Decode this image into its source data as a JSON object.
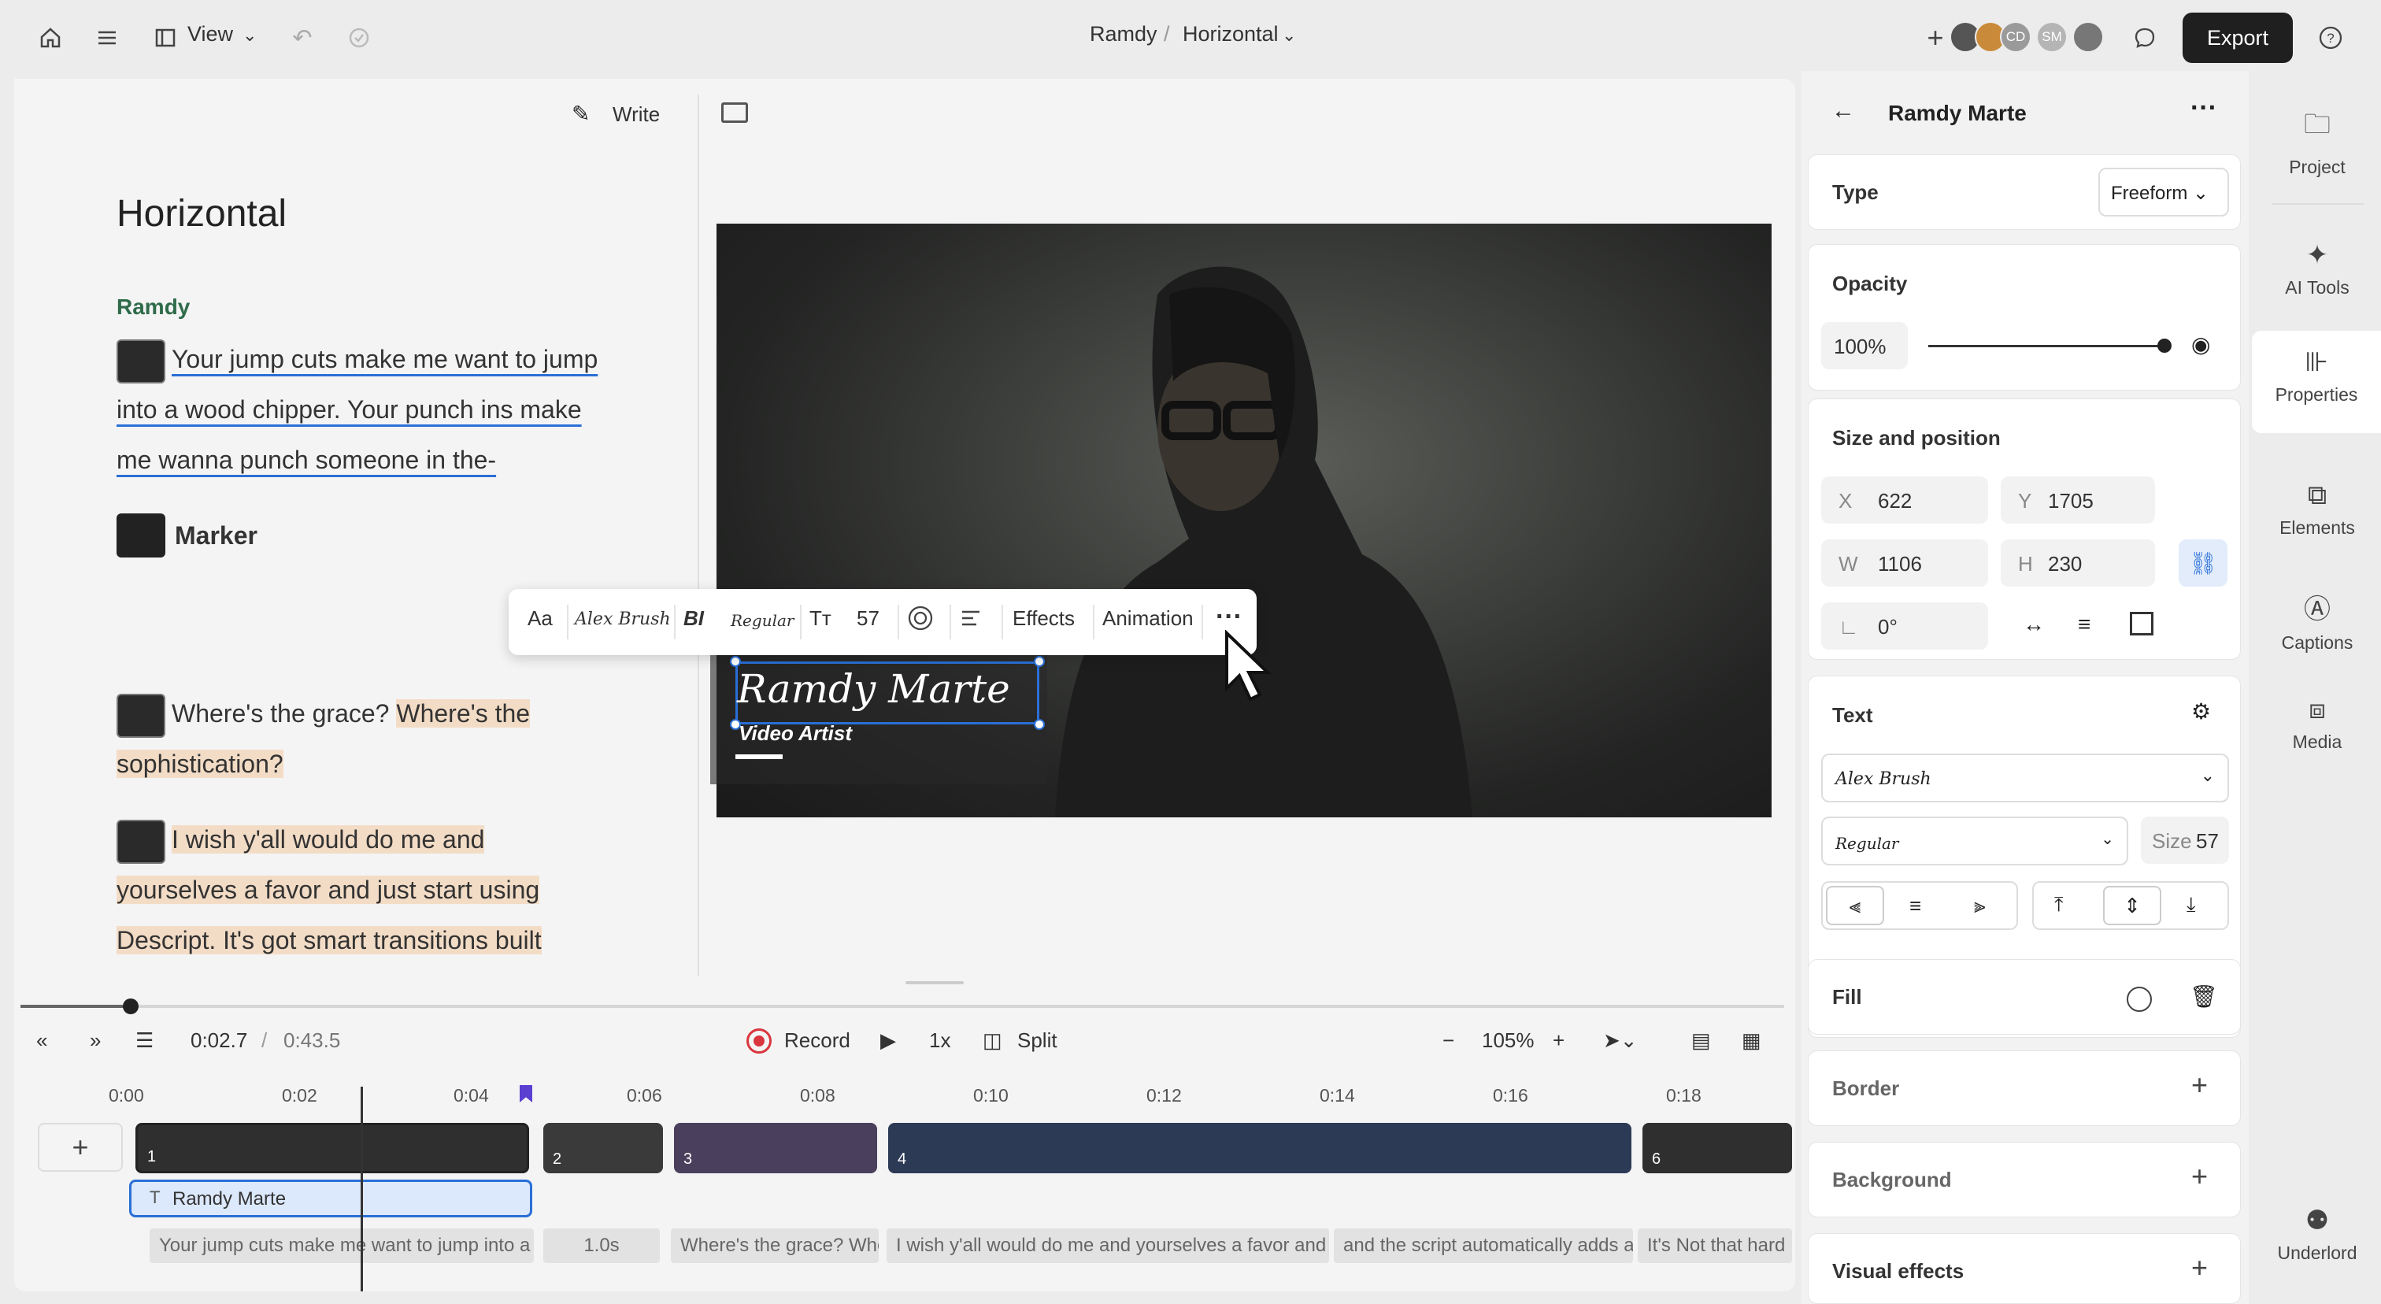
{
  "topbar": {
    "view_label": "View",
    "project_name": "Ramdy",
    "separator": "/",
    "composition": "Horizontal",
    "avatars": [
      "CD",
      "SM"
    ],
    "export_label": "Export"
  },
  "script": {
    "write_label": "Write",
    "title": "Horizontal",
    "speaker": "Ramdy",
    "para1": "Your jump cuts make me want to jump into a wood chipper. Your punch ins make me wanna punch someone in the-",
    "marker_label": "Marker",
    "para2_plain": "Where's the grace? ",
    "para2_highlight": "Where's the sophistication?",
    "para3": "I wish y'all would do me and yourselves a favor and just start using Descript. It's got smart transitions built"
  },
  "canvas": {
    "title_text": "Ramdy Marte",
    "subtitle_text": "Video Artist"
  },
  "format_bar": {
    "case_label": "Aa",
    "font_name": "Alex Brush",
    "style_label": "BI",
    "weight": "Regular",
    "size": "57",
    "effects_label": "Effects",
    "animation_label": "Animation"
  },
  "transport": {
    "current_time": "0:02.7",
    "separator": "/",
    "total_time": "0:43.5",
    "record_label": "Record",
    "speed": "1x",
    "split_label": "Split",
    "zoom": "105%"
  },
  "ruler": [
    "0:00",
    "0:02",
    "0:04",
    "0:06",
    "0:08",
    "0:10",
    "0:12",
    "0:14",
    "0:16",
    "0:18"
  ],
  "tracks": {
    "clip_numbers": [
      "1",
      "2",
      "3",
      "4",
      "6"
    ],
    "text_layer": "Ramdy Marte",
    "captions": [
      "Your jump cuts make me want to jump into a",
      "1.0s",
      "Where's the grace? Whe",
      "I wish y'all would do me and yourselves a favor and",
      "and the script automatically adds a",
      "It's Not that hard"
    ]
  },
  "properties": {
    "layer_name": "Ramdy Marte",
    "type_label": "Type",
    "type_value": "Freeform",
    "opacity_label": "Opacity",
    "opacity_value": "100%",
    "opacity_fraction": 1.0,
    "size_position_label": "Size and position",
    "x_label": "X",
    "x_value": "622",
    "y_label": "Y",
    "y_value": "1705",
    "w_label": "W",
    "w_value": "1106",
    "h_label": "H",
    "h_value": "230",
    "rotation_value": "0°",
    "text_label": "Text",
    "font_value": "Alex Brush",
    "weight_value": "Regular",
    "size_label": "Size",
    "size_value": "57",
    "fill_label": "Fill",
    "border_label": "Border",
    "background_label": "Background",
    "visual_effects_label": "Visual effects"
  },
  "rightnav": [
    {
      "label": "Project",
      "icon": "folder-icon"
    },
    {
      "label": "AI Tools",
      "icon": "sparkle-icon"
    },
    {
      "label": "Properties",
      "icon": "sliders-icon"
    },
    {
      "label": "Elements",
      "icon": "elements-icon"
    },
    {
      "label": "Captions",
      "icon": "captions-icon"
    },
    {
      "label": "Media",
      "icon": "media-icon"
    },
    {
      "label": "Underlord",
      "icon": "robot-icon"
    }
  ],
  "colors": {
    "accent": "#2a6fd6",
    "speaker_green": "#2f6b4a",
    "highlight": "#f3dcc6",
    "record_red": "#d9363e"
  }
}
